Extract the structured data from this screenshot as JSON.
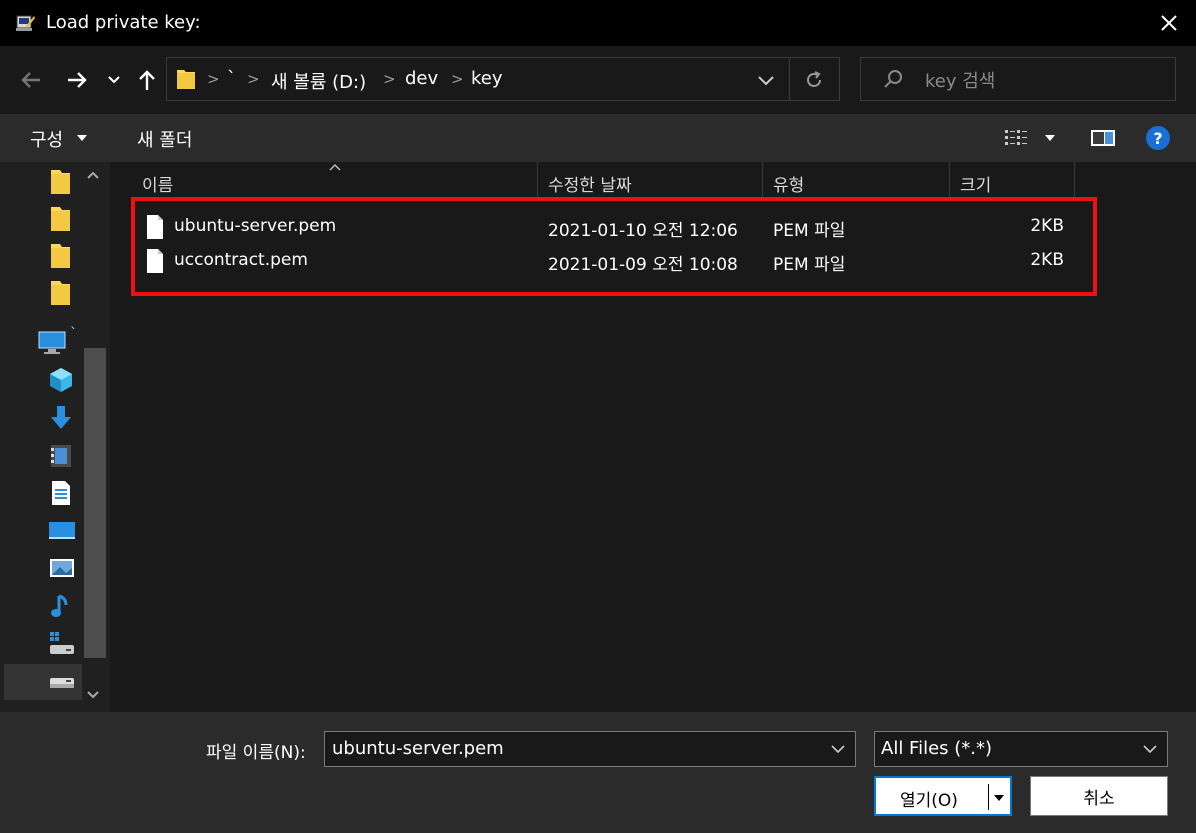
{
  "window": {
    "title": "Load private key:"
  },
  "address": {
    "crumbs": [
      "`",
      "새 볼륨 (D:)",
      "dev",
      "key"
    ]
  },
  "search": {
    "placeholder": "key 검색"
  },
  "toolbar": {
    "organize_label": "구성",
    "new_folder_label": "새 폴더"
  },
  "columns": {
    "name": "이름",
    "date": "수정한 날짜",
    "type": "유형",
    "size": "크기"
  },
  "files": [
    {
      "name": "ubuntu-server.pem",
      "date": "2021-01-10 오전 12:06",
      "type": "PEM 파일",
      "size": "2KB"
    },
    {
      "name": "uccontract.pem",
      "date": "2021-01-09 오전 10:08",
      "type": "PEM 파일",
      "size": "2KB"
    }
  ],
  "footer": {
    "filename_label": "파일 이름(N):",
    "filename_value": "ubuntu-server.pem",
    "filter_value": "All Files (*.*)",
    "open_label": "열기(O)",
    "cancel_label": "취소"
  },
  "sidebar": {
    "items": [
      {
        "icon": "folder-icon"
      },
      {
        "icon": "folder-icon"
      },
      {
        "icon": "folder-icon"
      },
      {
        "icon": "folder-icon"
      },
      {
        "icon": "computer-icon",
        "label": "`"
      },
      {
        "icon": "3d-objects-icon"
      },
      {
        "icon": "downloads-icon"
      },
      {
        "icon": "videos-icon"
      },
      {
        "icon": "documents-icon"
      },
      {
        "icon": "desktop-icon"
      },
      {
        "icon": "pictures-icon"
      },
      {
        "icon": "music-icon"
      },
      {
        "icon": "local-disk-c-icon"
      },
      {
        "icon": "drive-d-icon"
      }
    ]
  },
  "colors": {
    "highlight": "#ee1111",
    "accent": "#0078d7",
    "folder": "#ffd75e"
  }
}
